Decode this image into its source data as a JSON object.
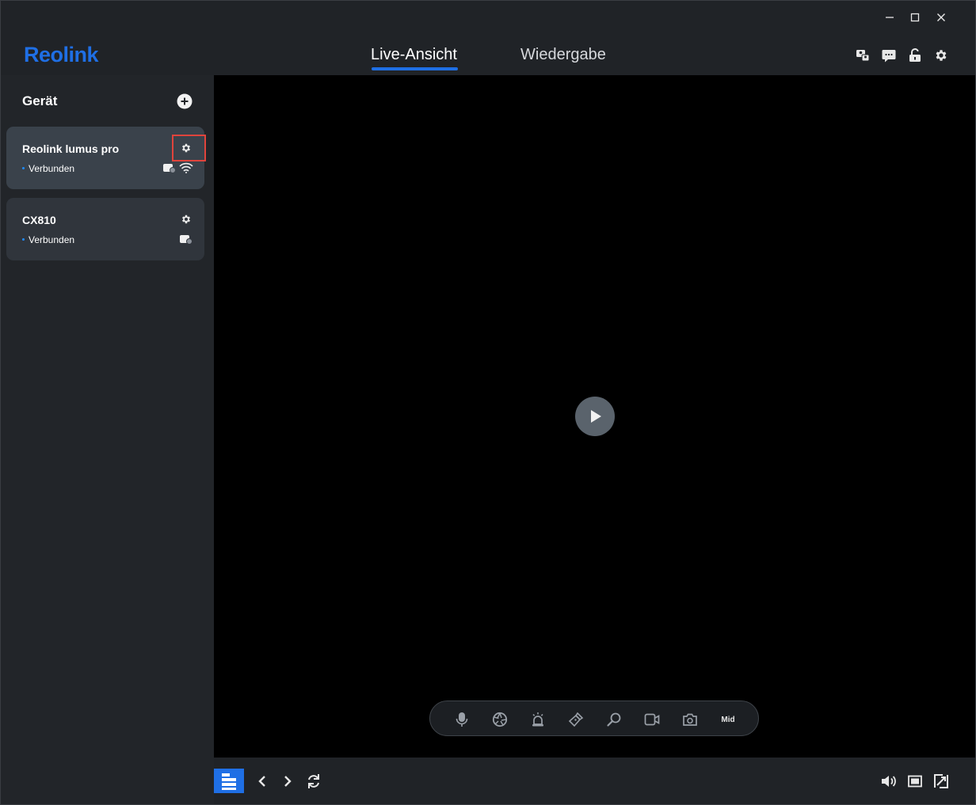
{
  "app": {
    "logo_text": "Reolink",
    "colors": {
      "accent": "#1f6fe5",
      "background": "#202327",
      "card_selected": "#3a424b",
      "card": "#30353c",
      "status_dot": "#1f8cff",
      "highlight": "#e0443c"
    }
  },
  "window_controls": {
    "minimize_icon": "minimize-icon",
    "maximize_icon": "maximize-icon",
    "close_icon": "close-icon"
  },
  "header": {
    "tabs": [
      {
        "label": "Live-Ansicht",
        "active": true
      },
      {
        "label": "Wiedergabe",
        "active": false
      }
    ],
    "icons": [
      "users-icon",
      "message-icon",
      "unlock-icon",
      "gear-icon"
    ]
  },
  "sidebar": {
    "title": "Gerät",
    "add_icon": "plus-circle-icon",
    "devices": [
      {
        "name": "Reolink lumus pro",
        "status": "Verbunden",
        "selected": true,
        "icons": [
          "gear-icon",
          "camera-share-icon",
          "wifi-icon"
        ]
      },
      {
        "name": "CX810",
        "status": "Verbunden",
        "selected": false,
        "icons": [
          "gear-icon",
          "camera-share-icon"
        ]
      }
    ]
  },
  "video": {
    "play_icon": "play-icon",
    "controls": [
      {
        "icon": "microphone-icon"
      },
      {
        "icon": "aperture-icon"
      },
      {
        "icon": "siren-icon"
      },
      {
        "icon": "flashlight-icon"
      },
      {
        "icon": "zoom-icon"
      },
      {
        "icon": "record-icon"
      },
      {
        "icon": "snapshot-icon"
      },
      {
        "label": "Mid"
      }
    ]
  },
  "bottom_bar": {
    "left_icons": [
      "layout-icon",
      "chevron-left-icon",
      "chevron-right-icon",
      "refresh-icon"
    ],
    "right_icons": [
      "volume-icon",
      "screen-icon",
      "fullscreen-icon"
    ]
  }
}
